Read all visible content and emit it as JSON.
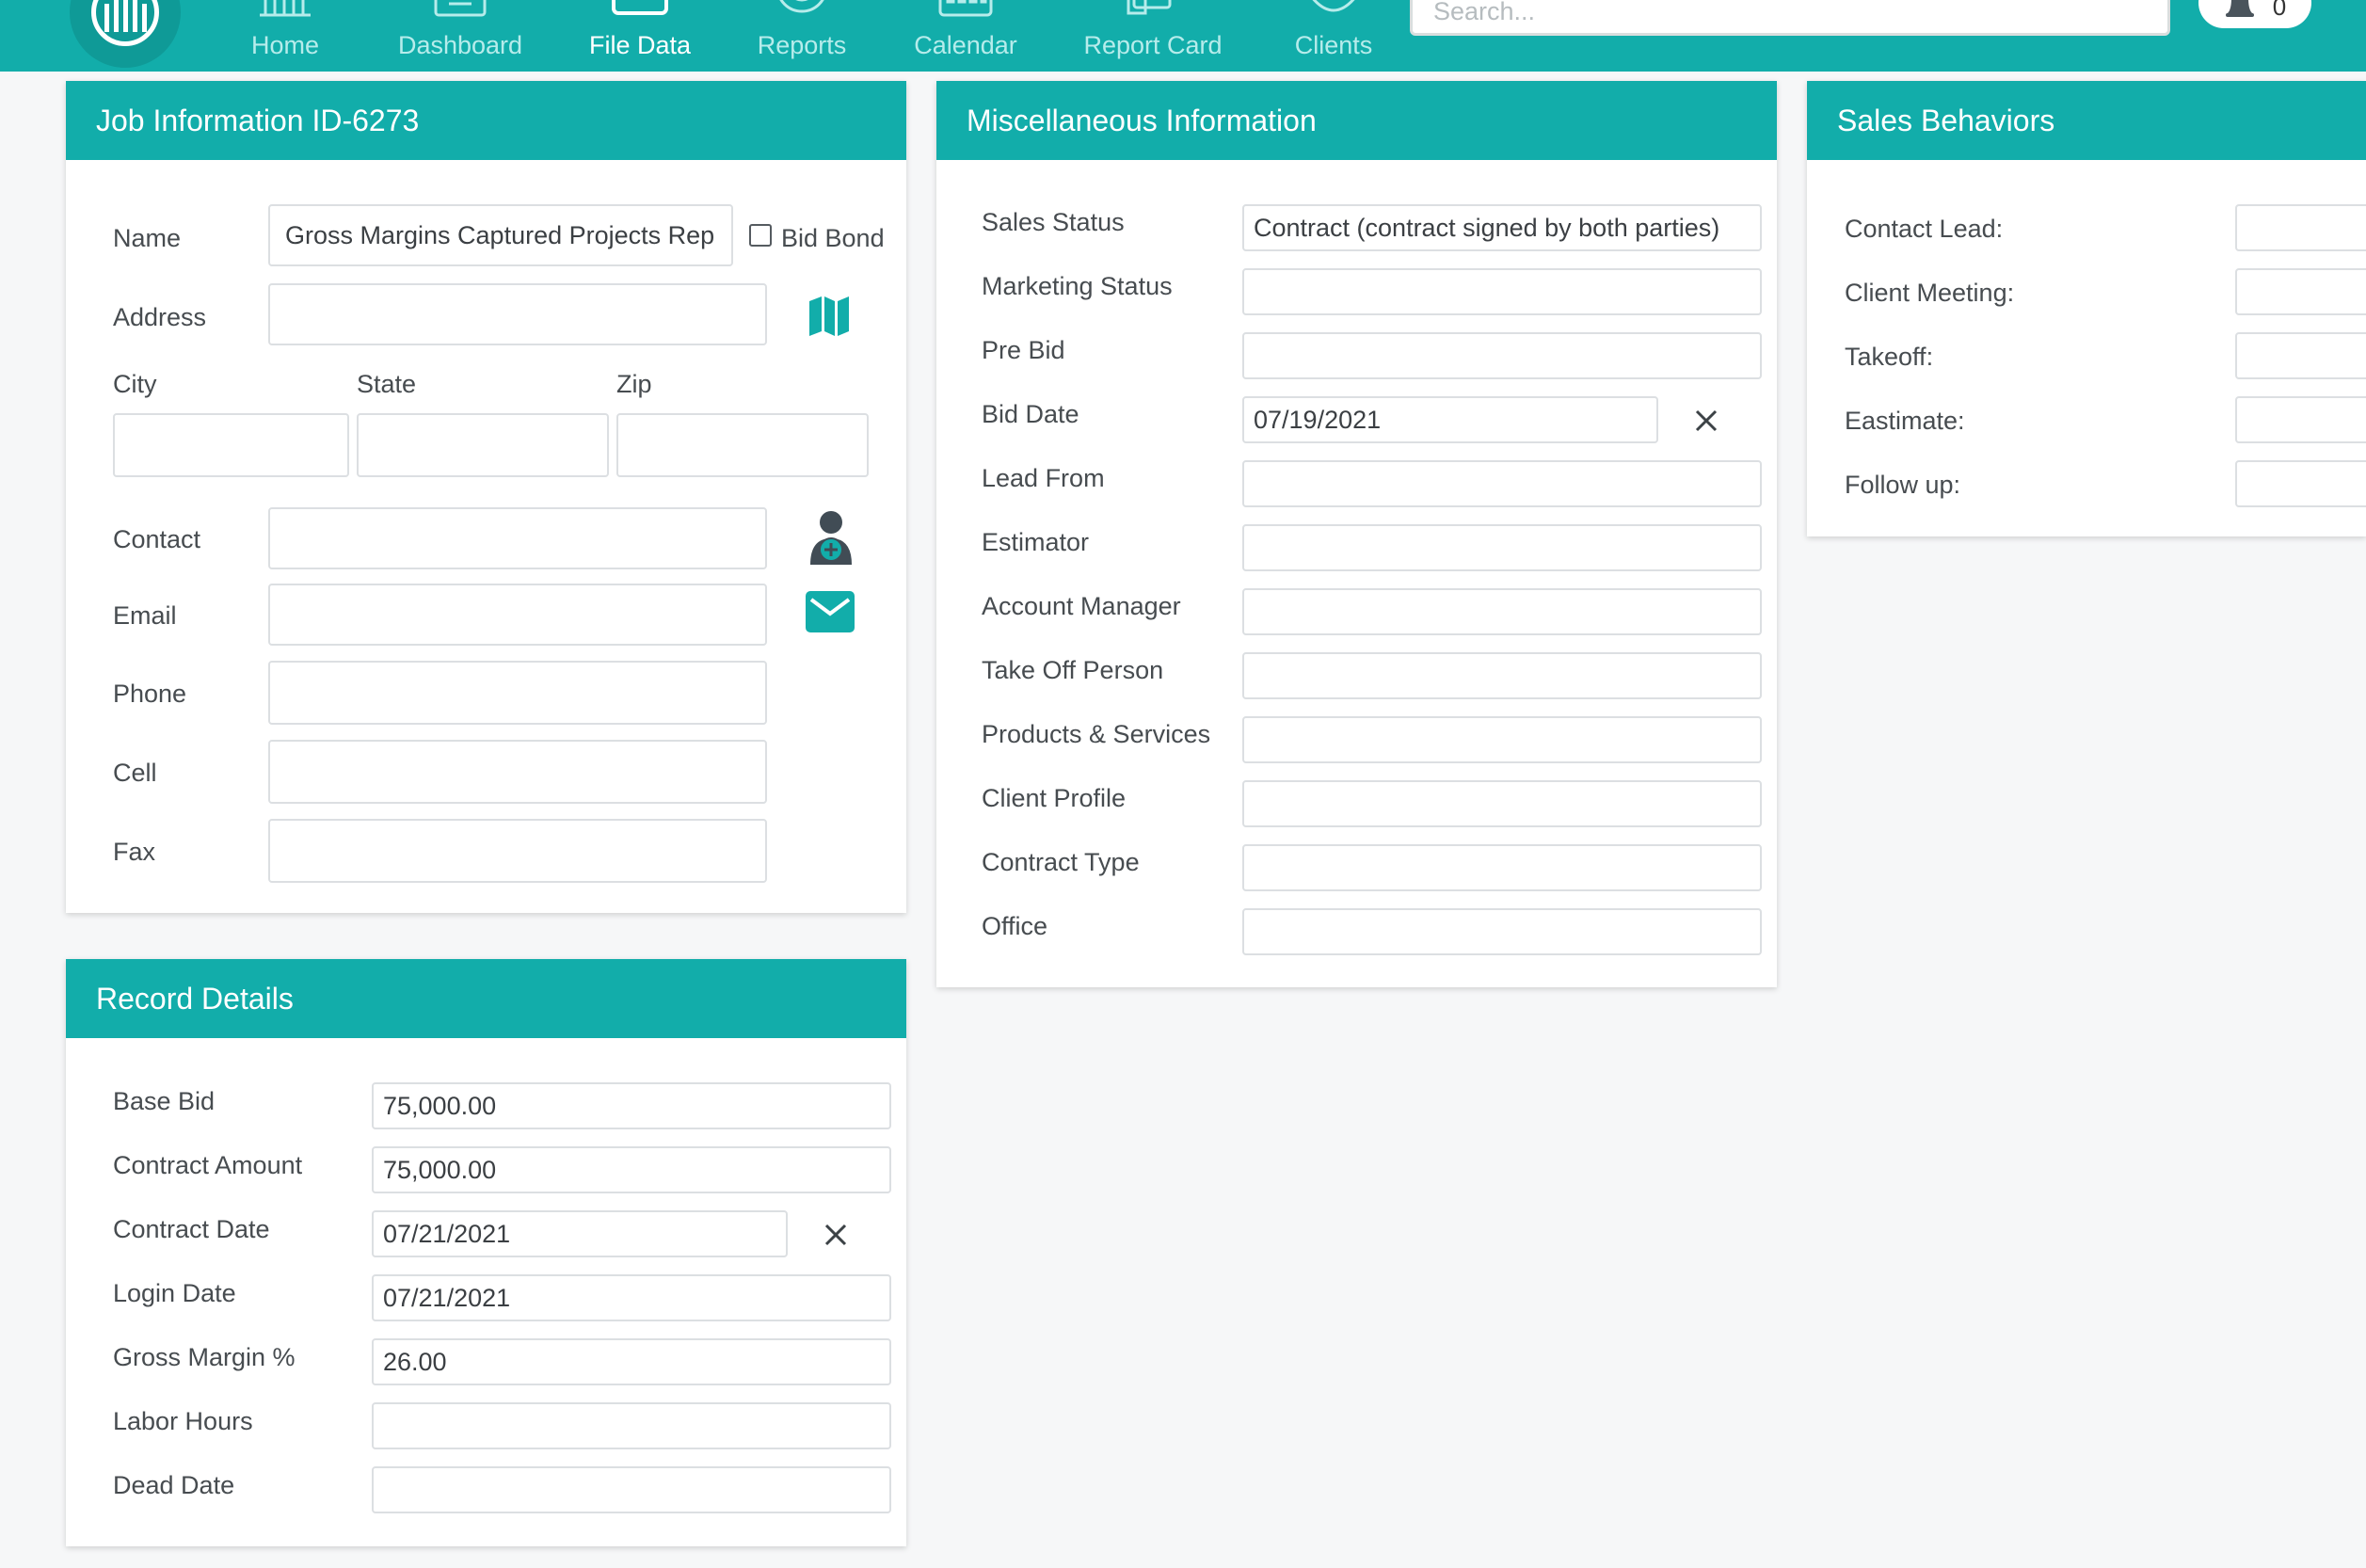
{
  "nav": {
    "items": [
      {
        "label": "Home"
      },
      {
        "label": "Dashboard"
      },
      {
        "label": "File Data"
      },
      {
        "label": "Reports"
      },
      {
        "label": "Calendar"
      },
      {
        "label": "Report Card"
      },
      {
        "label": "Clients"
      }
    ],
    "active": "File Data",
    "search_placeholder": "Search...",
    "notification_count": "0"
  },
  "job_info": {
    "title": "Job Information ID-6273",
    "name_label": "Name",
    "name_value": "Gross Margins Captured Projects Rep",
    "bid_bond_label": "Bid Bond",
    "bid_bond_checked": false,
    "address_label": "Address",
    "address_value": "",
    "city_label": "City",
    "state_label": "State",
    "zip_label": "Zip",
    "city_value": "",
    "state_value": "",
    "zip_value": "",
    "contact_label": "Contact",
    "contact_value": "",
    "email_label": "Email",
    "email_value": "",
    "phone_label": "Phone",
    "phone_value": "",
    "cell_label": "Cell",
    "cell_value": "",
    "fax_label": "Fax",
    "fax_value": ""
  },
  "record_details": {
    "title": "Record Details",
    "rows": [
      {
        "label": "Base Bid",
        "value": "75,000.00"
      },
      {
        "label": "Contract Amount",
        "value": "75,000.00"
      },
      {
        "label": "Contract Date",
        "value": "07/21/2021"
      },
      {
        "label": "Login Date",
        "value": "07/21/2021"
      },
      {
        "label": "Gross Margin %",
        "value": "26.00"
      },
      {
        "label": "Labor Hours",
        "value": ""
      },
      {
        "label": "Dead Date",
        "value": ""
      }
    ]
  },
  "misc_info": {
    "title": "Miscellaneous Information",
    "rows": [
      {
        "label": "Sales Status",
        "value": "Contract (contract signed by both parties)"
      },
      {
        "label": "Marketing Status",
        "value": ""
      },
      {
        "label": "Pre Bid",
        "value": ""
      },
      {
        "label": "Bid Date",
        "value": "07/19/2021"
      },
      {
        "label": "Lead From",
        "value": ""
      },
      {
        "label": "Estimator",
        "value": ""
      },
      {
        "label": "Account Manager",
        "value": ""
      },
      {
        "label": "Take Off Person",
        "value": ""
      },
      {
        "label": "Products & Services",
        "value": ""
      },
      {
        "label": "Client Profile",
        "value": ""
      },
      {
        "label": "Contract Type",
        "value": ""
      },
      {
        "label": "Office",
        "value": ""
      }
    ]
  },
  "sales_behaviors": {
    "title": "Sales Behaviors",
    "rows": [
      {
        "label": "Contact Lead:",
        "value": ""
      },
      {
        "label": "Client Meeting:",
        "value": ""
      },
      {
        "label": "Takeoff:",
        "value": ""
      },
      {
        "label": "Eastimate:",
        "value": ""
      },
      {
        "label": "Follow up:",
        "value": ""
      }
    ]
  },
  "icons": {
    "map": "map-icon",
    "add_contact": "add-contact-icon",
    "email": "envelope-icon",
    "clear": "close-icon",
    "bell": "bell-icon"
  },
  "colors": {
    "brand": "#12adaa",
    "nav_inactive_text": "#b6eceb",
    "page_bg": "#f6f7f8",
    "icon_dark": "#414c55"
  }
}
